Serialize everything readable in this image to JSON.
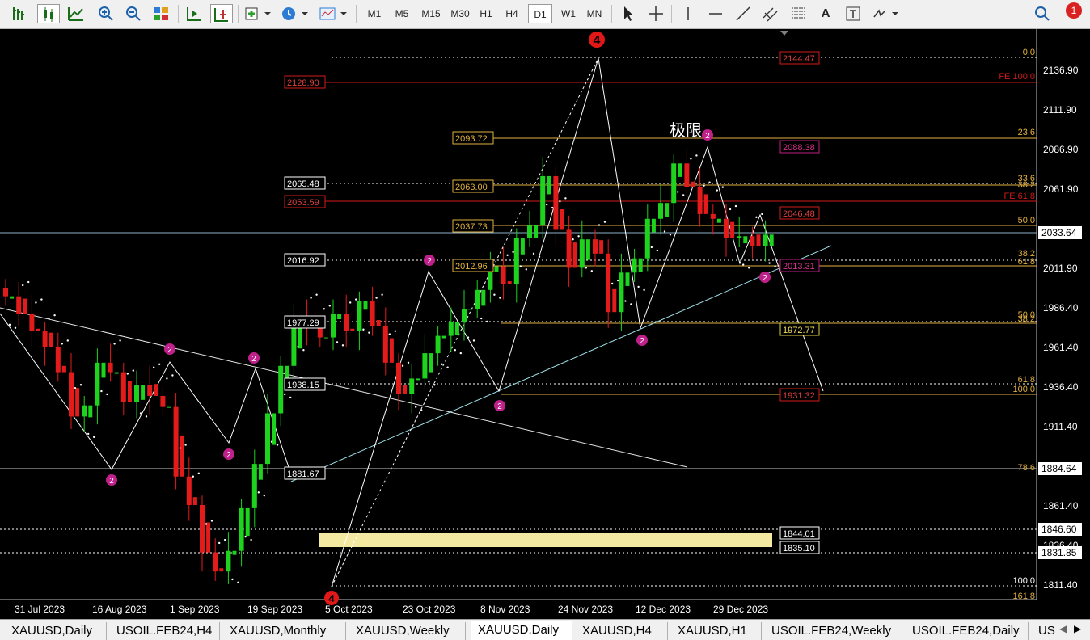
{
  "toolbar": {
    "timeframes": [
      "M1",
      "M5",
      "M15",
      "M30",
      "H1",
      "H4",
      "D1",
      "W1",
      "MN"
    ],
    "active_timeframe": "D1",
    "notification_count": "1"
  },
  "chart_data": {
    "type": "candlestick",
    "symbol": "XAUUSD",
    "timeframe": "Daily",
    "price_axis": [
      "2136.90",
      "2111.90",
      "2086.90",
      "2061.90",
      "2011.90",
      "1986.40",
      "1961.40",
      "1936.40",
      "1911.40",
      "1861.40",
      "1836.40",
      "1811.40"
    ],
    "price_markers": {
      "current": "2033.64",
      "level_a": "1884.64",
      "level_b": "1846.60",
      "level_c": "1831.85"
    },
    "date_axis": [
      "31 Jul 2023",
      "16 Aug 2023",
      "1 Sep 2023",
      "19 Sep 2023",
      "5 Oct 2023",
      "23 Oct 2023",
      "8 Nov 2023",
      "24 Nov 2023",
      "12 Dec 2023",
      "29 Dec 2023"
    ],
    "boxed_levels_left": [
      "2128.90",
      "2065.48",
      "2053.59",
      "2016.92",
      "1977.29",
      "1938.15",
      "1881.67"
    ],
    "boxed_levels_mid": [
      "2093.72",
      "2063.00",
      "2037.73",
      "2012.96"
    ],
    "boxed_levels_right": [
      "2144.47",
      "2088.38",
      "2046.48",
      "2013.31",
      "1972.77",
      "1931.32",
      "1844.01",
      "1835.10"
    ],
    "fib_labels": [
      "0.0",
      "FE 100.0",
      "23.6",
      "33.6",
      "38.2",
      "FE 61.8",
      "50.0",
      "38.2",
      "61.8",
      "50.0",
      "38.2",
      "61.8",
      "100.0",
      "78.6",
      "100.0",
      "161.8"
    ],
    "annotation_text": "极限",
    "wave_labels": [
      "4",
      "2",
      "2",
      "2",
      "2",
      "2",
      "2",
      "2",
      "2",
      "2",
      "4"
    ],
    "candles_close_trend": [
      1994,
      1983,
      1972,
      1962,
      1946,
      1918,
      1925,
      1952,
      1946,
      1927,
      1938,
      1931,
      1924,
      1880,
      1862,
      1832,
      1820,
      1833,
      1860,
      1888,
      1920,
      1950,
      1980,
      1975,
      1968,
      1983,
      1972,
      1991,
      1975,
      1952,
      1932,
      1942,
      1958,
      1969,
      1978,
      1986,
      1998,
      2013,
      2002,
      2031,
      2039,
      2070,
      2036,
      2012,
      2030,
      2021,
      1984,
      2009,
      2018,
      2043,
      2053,
      2078,
      2063,
      2046,
      2043,
      2031,
      2032,
      2026,
      2033
    ]
  },
  "tabs": [
    "XAUUSD,Daily",
    "USOIL.FEB24,H4",
    "XAUUSD,Monthly",
    "XAUUSD,Weekly",
    "XAUUSD,Daily",
    "XAUUSD,H4",
    "XAUUSD,H1",
    "USOIL.FEB24,Weekly",
    "USOIL.FEB24,Daily",
    "US"
  ],
  "active_tab_index": 4
}
